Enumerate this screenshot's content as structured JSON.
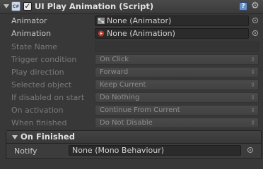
{
  "component": {
    "title": "UI Play Animation (Script)",
    "enabled": true,
    "script_icon_glyph": "C#",
    "help_glyph": "?",
    "gear_glyph": "⚙"
  },
  "fields": {
    "animator": {
      "label": "Animator",
      "value": "None (Animator)",
      "icon": "animator-icon"
    },
    "animation": {
      "label": "Animation",
      "value": "None (Animation)",
      "icon": "animation-icon"
    },
    "state_name": {
      "label": "State Name",
      "value": ""
    },
    "trigger_condition": {
      "label": "Trigger condition",
      "value": "On Click"
    },
    "play_direction": {
      "label": "Play direction",
      "value": "Forward"
    },
    "selected_object": {
      "label": "Selected object",
      "value": "Keep Current"
    },
    "if_disabled": {
      "label": "If disabled on start",
      "value": "Do Nothing"
    },
    "on_activation": {
      "label": "On activation",
      "value": "Continue From Current"
    },
    "when_finished": {
      "label": "When finished",
      "value": "Do Not Disable"
    }
  },
  "on_finished": {
    "title": "On Finished",
    "notify_label": "Notify",
    "notify_value": "None (Mono Behaviour)"
  },
  "dropdown_arrow": "⇕",
  "colors": {
    "background": "#383838",
    "label_enabled": "#c8c8c8",
    "label_disabled": "#7a7a7a"
  }
}
